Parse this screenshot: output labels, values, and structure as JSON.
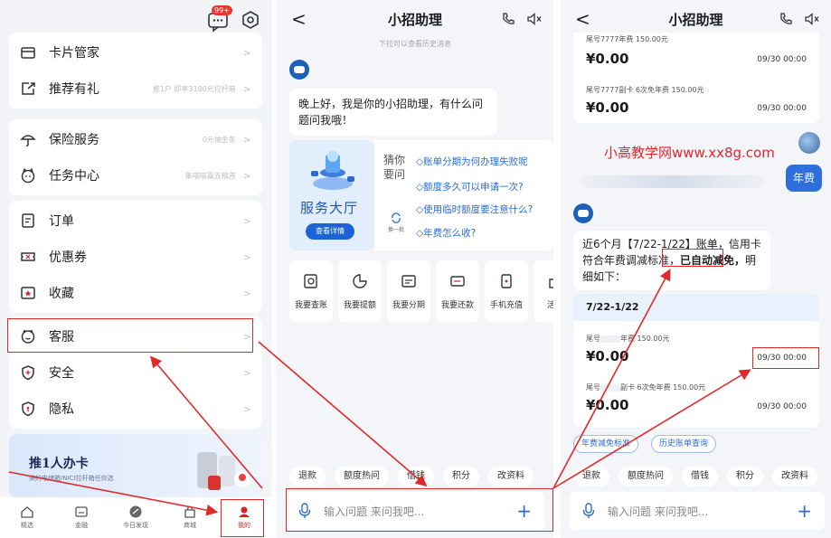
{
  "menu": {
    "badge": "99+",
    "items": [
      {
        "label": "卡片管家",
        "hint": ""
      },
      {
        "label": "推荐有礼",
        "hint": "推1户 即享3180元拉杆箱"
      },
      {
        "label": "保险服务",
        "hint": "0元抽金条"
      },
      {
        "label": "任务中心",
        "hint": "集喵喵赢五粮液"
      },
      {
        "label": "订单",
        "hint": ""
      },
      {
        "label": "优惠券",
        "hint": ""
      },
      {
        "label": "收藏",
        "hint": ""
      },
      {
        "label": "客服",
        "hint": ""
      },
      {
        "label": "安全",
        "hint": ""
      },
      {
        "label": "隐私",
        "hint": ""
      }
    ],
    "arrow": ">",
    "promo": {
      "title": "推1人办卡",
      "subtitle": "美的电烤箱/NICI拉杆箱任你选"
    },
    "nav": [
      "精选",
      "金融",
      "今日发现",
      "商城",
      "我的"
    ]
  },
  "chat": {
    "back": "<",
    "title": "小招助理",
    "history_hint": "下拉可以查看历史消息",
    "greeting": "晚上好，我是你的小招助理，有什么问题问我哦！",
    "service": {
      "title": "服务大厅",
      "button": "查看详情"
    },
    "guess": {
      "label": "猜你要问",
      "swap": "换一批",
      "questions": [
        "◇账单分期为何办理失败呢",
        "◇额度多久可以申请一次?",
        "◇使用临时额度要注意什么?",
        "◇年费怎么收?"
      ]
    },
    "shortcuts": [
      "我要查账",
      "我要提额",
      "我要分期",
      "我要还款",
      "手机充值",
      "活动"
    ],
    "chips": [
      "退款",
      "额度热问",
      "借钱",
      "积分",
      "改资料"
    ],
    "input_placeholder": "输入问题 来问我吧...",
    "plus": "+"
  },
  "chat2": {
    "top_line": "尾号7777年费 150.00元",
    "top_amount": "¥0.00",
    "top_date": "09/30 00:00",
    "row2_name": "尾号7777副卡  6次免年费 150.00元",
    "row2_amount": "¥0.00",
    "row2_date": "09/30 00:00",
    "watermark": "小高教学网www.xx8g.com",
    "user_msg": "年费",
    "reply_pre": "近6个月【7/22-1/22】账单，信用卡符合年费调减标准，",
    "reply_highlight": "已自动减免，",
    "reply_post": "明细如下：",
    "period": "7/22-1/22",
    "rows": [
      {
        "name_pre": "尾号",
        "name_post": "年费 150.00元",
        "amount": "¥0.00",
        "date": "09/30 00:00"
      },
      {
        "name_pre": "尾号",
        "name_post": "副卡  6次免年费 150.00元",
        "amount": "¥0.00",
        "date": "09/30 00:00"
      }
    ],
    "links": [
      "年费减免标准",
      "历史账单查询"
    ],
    "chips": [
      "退款",
      "额度热问",
      "借钱",
      "积分",
      "改资料"
    ],
    "input_placeholder": "输入问题 来问我吧...",
    "plus": "+"
  },
  "colors": {
    "annotation": "#e02a2a",
    "accent": "#2a6bd6",
    "brand_red": "#d71f26"
  }
}
